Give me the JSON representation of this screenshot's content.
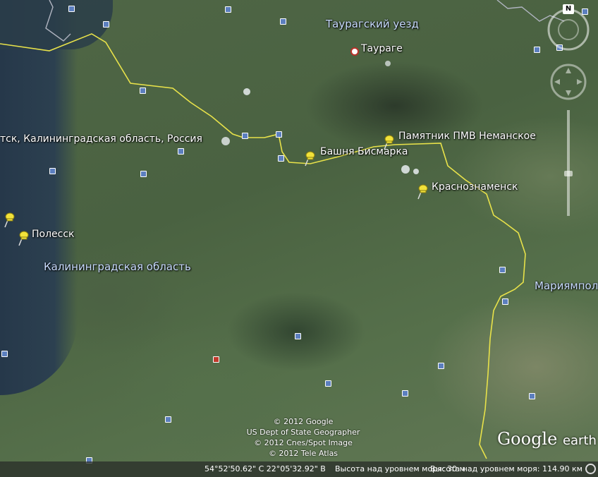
{
  "map": {
    "labels": {
      "region_taurage": "Таурагский уезд",
      "city_taurage": "Таураге",
      "baltiysk": "тск, Калининградская область, Россия",
      "nemanskoe": "Памятник ПМВ Неманское",
      "bismarck": "Башня Бисмарка",
      "krasnoznamensk": "Краснознаменск",
      "polessk": "Полесск",
      "kaliningrad_region": "Калининградская область",
      "mariampol": "Мариямпол"
    },
    "copyright": {
      "line1": "© 2012 Google",
      "line2": "US Dept of State Geographer",
      "line3": "© 2012 Cnes/Spot Image",
      "line4": "© 2012 Tele Atlas"
    },
    "logo": {
      "main": "Google",
      "suffix": "earth"
    },
    "status": {
      "coords": "54°52'50.62\" С  22°05'32.92\" В",
      "elevation": "Высота над уровнем моря:  30 м",
      "eye_alt": "Высота над уровнем моря:   114.90 км"
    },
    "compass": {
      "north": "N"
    },
    "colors": {
      "border_line": "#e8e24a",
      "pin": "#f2e23a",
      "label_blue": "#c9dcff"
    }
  }
}
